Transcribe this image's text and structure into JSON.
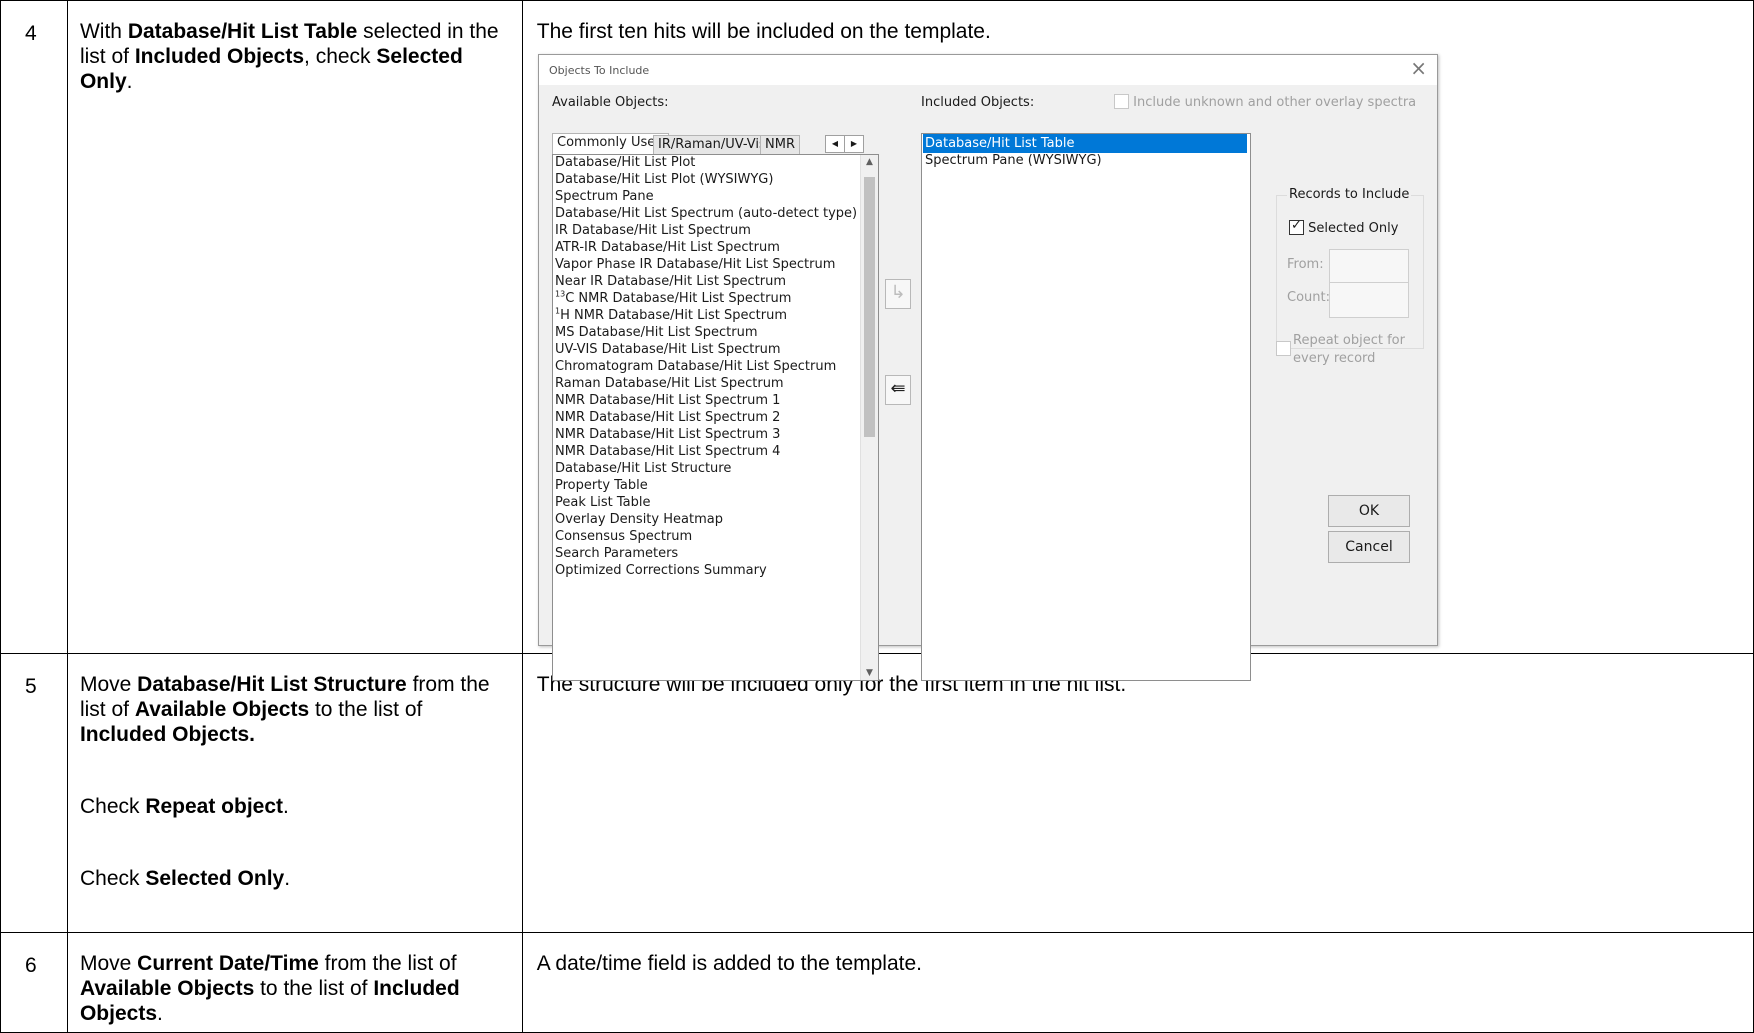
{
  "steps": [
    {
      "number": "4",
      "instruction": [
        {
          "t": "With ",
          "b": false
        },
        {
          "t": "Database/Hit List Table",
          "b": true
        },
        {
          "t": " selected in the list of ",
          "b": false
        },
        {
          "t": "Included Objects",
          "b": true
        },
        {
          "t": ", check ",
          "b": false
        },
        {
          "t": "Selected Only",
          "b": true
        },
        {
          "t": ".",
          "b": false
        }
      ],
      "result": "The first ten hits will be included on the template."
    },
    {
      "number": "5",
      "instruction_paragraphs": [
        [
          {
            "t": "Move ",
            "b": false
          },
          {
            "t": "Database/Hit List Structure",
            "b": true
          },
          {
            "t": " from the list of ",
            "b": false
          },
          {
            "t": "Available Objects",
            "b": true
          },
          {
            "t": " to the list of ",
            "b": false
          },
          {
            "t": "Included Objects.",
            "b": true
          }
        ],
        [
          {
            "t": "Check ",
            "b": false
          },
          {
            "t": "Repeat object",
            "b": true
          },
          {
            "t": ".",
            "b": false
          }
        ],
        [
          {
            "t": "Check ",
            "b": false
          },
          {
            "t": "Selected Only",
            "b": true
          },
          {
            "t": ".",
            "b": false
          }
        ]
      ],
      "result": "The structure will be included only for the first item in the hit list."
    },
    {
      "number": "6",
      "instruction": [
        {
          "t": "Move ",
          "b": false
        },
        {
          "t": "Current Date/Time",
          "b": true
        },
        {
          "t": " from the list of ",
          "b": false
        },
        {
          "t": "Available Objects",
          "b": true
        },
        {
          "t": " to the list of ",
          "b": false
        },
        {
          "t": "Included Objects",
          "b": true
        },
        {
          "t": ".",
          "b": false
        }
      ],
      "result": "A date/time field is added to the template."
    }
  ],
  "dialog": {
    "title": "Objects To Include",
    "close_glyph": "×",
    "available_label": "Available Objects:",
    "included_label": "Included Objects:",
    "include_unknown_label": "Include unknown and other overlay spectra",
    "tabs": [
      "Commonly Used",
      "IR/Raman/UV-Vis",
      "NMR"
    ],
    "available_items": [
      "Database/Hit List Plot",
      "Database/Hit List Plot (WYSIWYG)",
      "Spectrum Pane",
      "Database/Hit List Spectrum (auto-detect type)",
      "IR Database/Hit List Spectrum",
      "ATR-IR Database/Hit List Spectrum",
      "Vapor Phase IR Database/Hit List Spectrum",
      "Near IR Database/Hit List Spectrum",
      "C NMR Database/Hit List Spectrum",
      "H NMR Database/Hit List Spectrum",
      "MS Database/Hit List Spectrum",
      "UV-VIS Database/Hit List Spectrum",
      "Chromatogram Database/Hit List Spectrum",
      "Raman Database/Hit List Spectrum",
      "NMR Database/Hit List Spectrum 1",
      "NMR Database/Hit List Spectrum 2",
      "NMR Database/Hit List Spectrum 3",
      "NMR Database/Hit List Spectrum 4",
      "Database/Hit List Structure",
      "Property Table",
      "Peak List Table",
      "Overlay Density Heatmap",
      "Consensus Spectrum",
      "Search Parameters",
      "Optimized Corrections Summary"
    ],
    "superscripts": {
      "8": "13",
      "9": "1"
    },
    "included_items": [
      "Database/Hit List Table",
      "Spectrum Pane (WYSIWYG)"
    ],
    "records_group_title": "Records to Include",
    "selected_only_label": "Selected Only",
    "selected_only_checked": true,
    "from_label": "From:",
    "count_label": "Count:",
    "repeat_label_line1": "Repeat object for",
    "repeat_label_line2": "every record",
    "ok_label": "OK",
    "cancel_label": "Cancel",
    "add_arrow_glyph": "↳",
    "remove_arrow_glyph": "⇚"
  }
}
